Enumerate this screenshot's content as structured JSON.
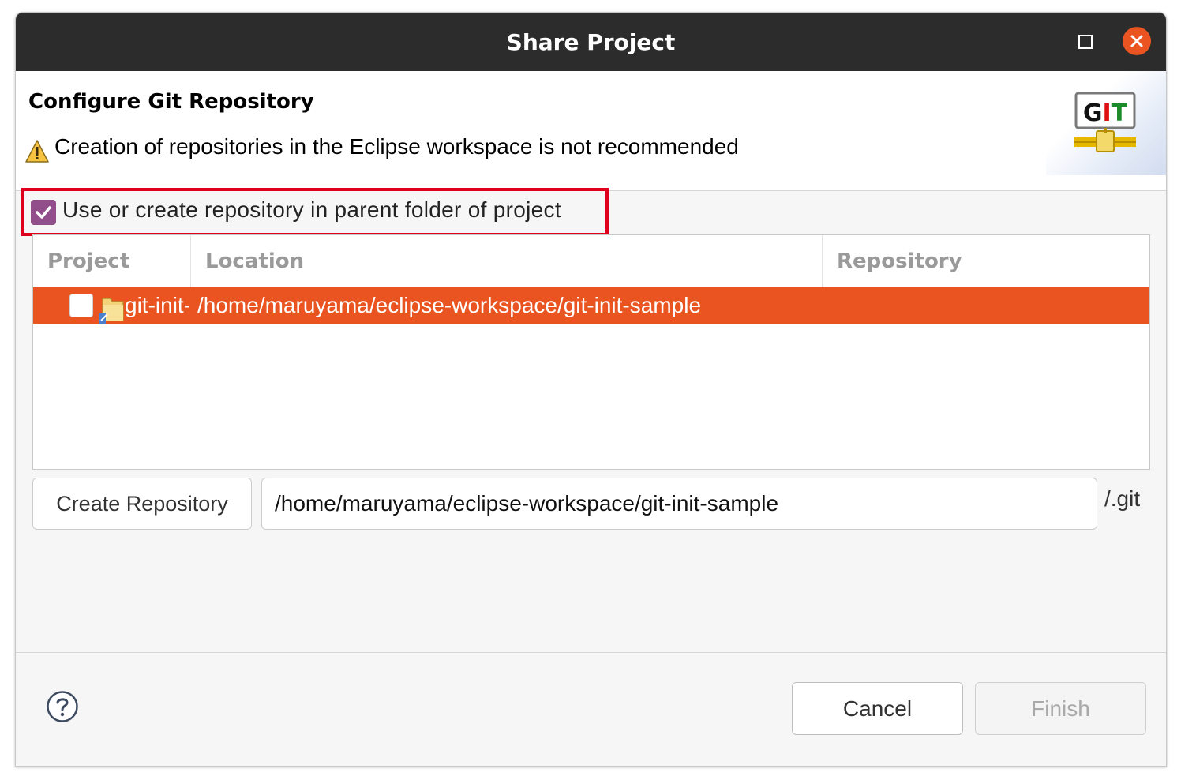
{
  "window": {
    "title": "Share Project"
  },
  "header": {
    "title": "Configure Git Repository",
    "warning": "Creation of repositories in the Eclipse workspace is not recommended",
    "logo_text": "GIT"
  },
  "options": {
    "use_parent_folder_label": "Use or create repository in parent folder of project",
    "use_parent_folder_checked": true
  },
  "table": {
    "columns": [
      "Project",
      "Location",
      "Repository"
    ],
    "rows": [
      {
        "project": "git-init-sample",
        "location": "/home/maruyama/eclipse-workspace/git-init-sample",
        "repository": "",
        "checked": false,
        "selected": true
      }
    ]
  },
  "repository": {
    "create_button_label": "Create Repository",
    "path_value": "/home/maruyama/eclipse-workspace/git-init-sample",
    "suffix": "/.git"
  },
  "footer": {
    "cancel_label": "Cancel",
    "finish_label": "Finish",
    "finish_enabled": false
  },
  "colors": {
    "titlebar": "#2c2c2c",
    "accent_orange": "#e95420",
    "checkbox_purple": "#924d8b",
    "highlight_red": "#e0001b"
  }
}
